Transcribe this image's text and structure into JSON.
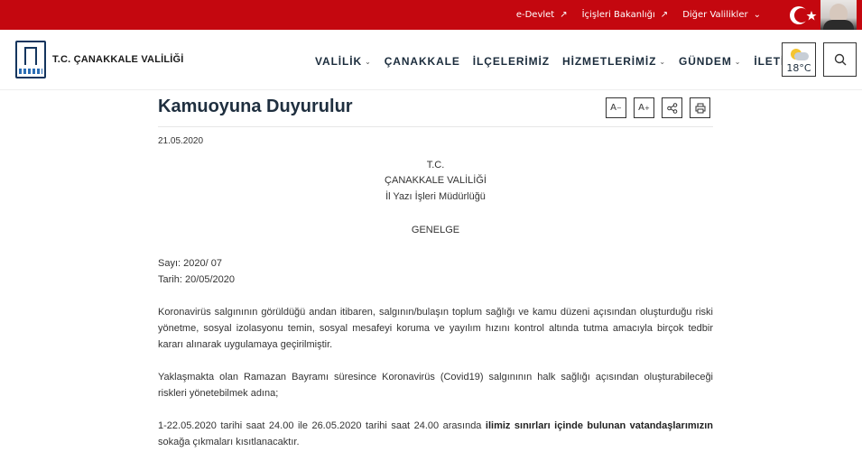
{
  "topbar": {
    "links": [
      {
        "label": "e-Devlet",
        "arrow": "↗"
      },
      {
        "label": "İçişleri Bakanlığı",
        "arrow": "↗"
      },
      {
        "label": "Diğer Valilikler",
        "arrow": "⌄"
      }
    ],
    "accent": "#c4070f"
  },
  "header": {
    "brand": "T.C. ÇANAKKALE VALİLİĞİ",
    "nav": [
      {
        "label": "VALİLİK",
        "dropdown": true
      },
      {
        "label": "ÇANAKKALE",
        "dropdown": false
      },
      {
        "label": "İLÇELERİMİZ",
        "dropdown": false
      },
      {
        "label": "HİZMETLERİMİZ",
        "dropdown": true
      },
      {
        "label": "GÜNDEM",
        "dropdown": true
      },
      {
        "label": "İLETİŞİM",
        "dropdown": false
      }
    ],
    "weather": {
      "temp": "18°C",
      "icon": "partly-cloudy-icon"
    }
  },
  "page": {
    "title": "Kamuoyuna Duyurulur",
    "tools": {
      "font_down": "A",
      "font_down_sup": "−",
      "font_up": "A",
      "font_up_sup": "+"
    },
    "date": "21.05.2020"
  },
  "document": {
    "heading_1": "T.C.",
    "heading_2": "ÇANAKKALE VALİLİĞİ",
    "heading_3": "İl Yazı İşleri Müdürlüğü",
    "heading_4": "GENELGE",
    "sayi": "Sayı: 2020/ 07",
    "tarih": "Tarih: 20/05/2020",
    "para_1": "Koronavirüs salgınının görüldüğü andan itibaren, salgının/bulaşın toplum sağlığı ve kamu düzeni açısından oluşturduğu riski yönetme, sosyal izolasyonu temin, sosyal mesafeyi koruma ve yayılım hızını kontrol altında tutma amacıyla birçok tedbir kararı alınarak uygulamaya geçirilmiştir.",
    "para_2": "Yaklaşmakta olan Ramazan Bayramı süresince Koronavirüs (Covid19) salgınının halk sağlığı açısından oluşturabileceği riskleri yönetebilmek adına;",
    "para_3_start": "1-22.05.2020 tarihi saat 24.00 ile 26.05.2020 tarihi saat 24.00 arasında ",
    "para_3_bold": "ilimiz sınırları içinde bulunan vatandaşlarımızın",
    "para_3_end": " sokağa çıkmaları kısıtlanacaktır."
  }
}
